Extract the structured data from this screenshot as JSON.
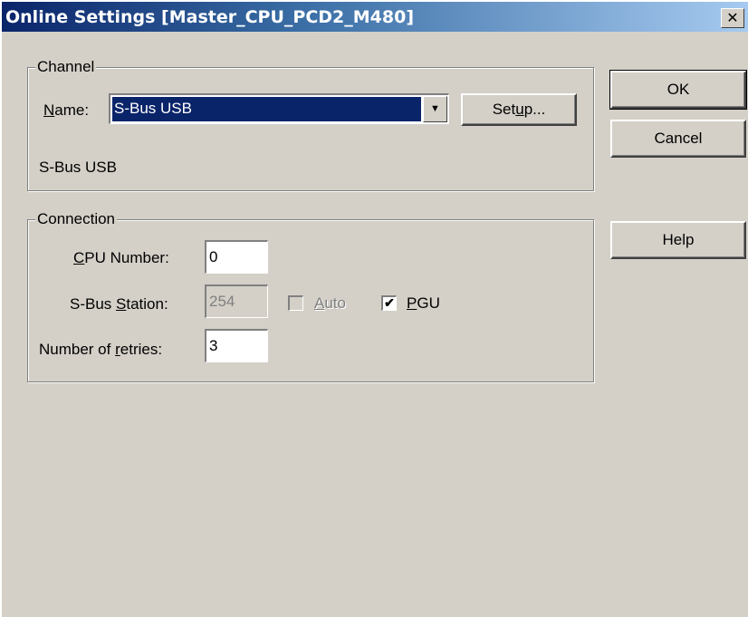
{
  "window": {
    "title": "Online Settings [Master_CPU_PCD2_M480]",
    "close_glyph": "✕"
  },
  "channel": {
    "legend": "Channel",
    "name_label_prefix": "",
    "name_label_u": "N",
    "name_label_rest": "ame:",
    "name_value": "S-Bus USB",
    "setup_pre": "Set",
    "setup_u": "u",
    "setup_post": "p...",
    "description": "S-Bus USB"
  },
  "connection": {
    "legend": "Connection",
    "cpu_label_u": "C",
    "cpu_label_rest": "PU Number:",
    "cpu_value": "0",
    "station_label_pre": "S-Bus ",
    "station_label_u": "S",
    "station_label_rest": "tation:",
    "station_value": "254",
    "auto_u": "A",
    "auto_rest": "uto",
    "auto_checked": false,
    "pgu_u": "P",
    "pgu_rest": "GU",
    "pgu_checked": true,
    "retries_label_pre": "Number of ",
    "retries_label_u": "r",
    "retries_label_rest": "etries:",
    "retries_value": "3"
  },
  "buttons": {
    "ok": "OK",
    "cancel": "Cancel",
    "help": "Help"
  },
  "icons": {
    "dropdown_arrow": "▼",
    "check": "✔"
  },
  "colors": {
    "face": "#d4d0c8",
    "title_start": "#0a246a",
    "title_end": "#a6caf0",
    "selection": "#0a246a"
  }
}
